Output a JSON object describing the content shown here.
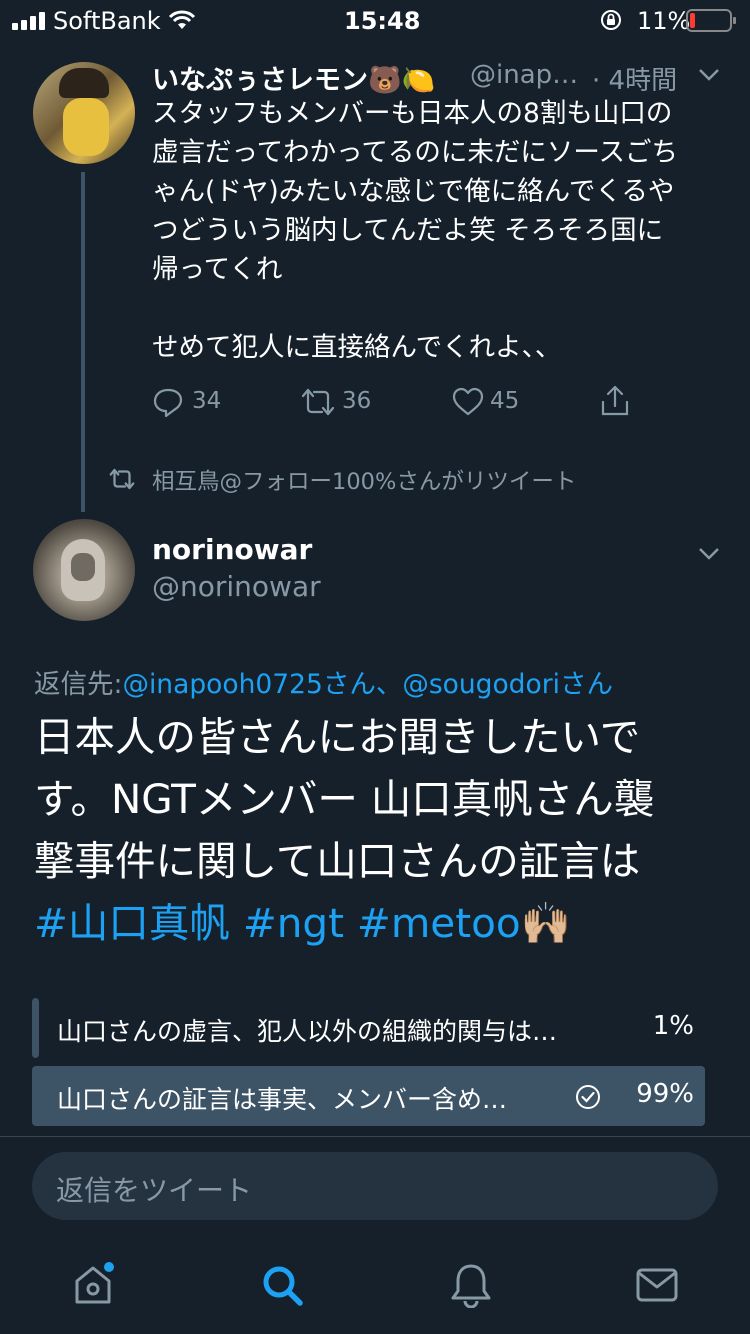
{
  "status_bar": {
    "carrier": "SoftBank",
    "time": "15:48",
    "battery": "11%"
  },
  "quoted_tweet": {
    "display_name": "いなぷぅさレモン🐻🍋",
    "handle": "@inap…",
    "time": "· 4時間",
    "text": "スタッフもメンバーも日本人の8割も山口の\n虚言だってわかってるのに未だにソースごち\nゃん(ドヤ)みたいな感じで俺に絡んでくるや\nつどういう脳内してんだよ笑 そろそろ国に\n帰ってくれ\n\nせめて犯人に直接絡んでくれよ、、",
    "reply_count": "34",
    "retweet_count": "36",
    "like_count": "45"
  },
  "retweet_notice": "相互鳥@フォロー100%さんがリツイート",
  "main_tweet": {
    "display_name": "norinowar",
    "handle": "@norinowar",
    "reply_to_label": "返信先:",
    "reply_to_user1": "@inapooh0725さん、",
    "reply_to_user2": "@sougodoriさん",
    "text_line1": "日本人の皆さんにお聞きしたいで",
    "text_line2": "す。NGTメンバー 山口真帆さん襲",
    "text_line3": "撃事件に関して山口さんの証言は",
    "hashtag1": "#山口真帆",
    "hashtag2": "#ngt",
    "hashtag3": "#metoo",
    "emoji": "🙌🏼"
  },
  "poll": {
    "options": [
      {
        "label": "山口さんの虚言、犯人以外の組織的関与は…",
        "percent": "1%",
        "value": 1
      },
      {
        "label": "山口さんの証言は事実、メンバー含め…",
        "percent": "99%",
        "value": 99
      }
    ]
  },
  "reply_bar": {
    "placeholder": "返信をツイート"
  },
  "tab_bar": {
    "items": [
      "home-icon",
      "search-icon",
      "notifications-icon",
      "messages-icon"
    ],
    "active": "search-icon"
  },
  "colors": {
    "background": "#15202b",
    "accent": "#1da1f2",
    "secondary_text": "#8899a6",
    "poll_fill": "#3d5466",
    "reply_bar": "#253341",
    "battery_low": "#ff3b30"
  }
}
